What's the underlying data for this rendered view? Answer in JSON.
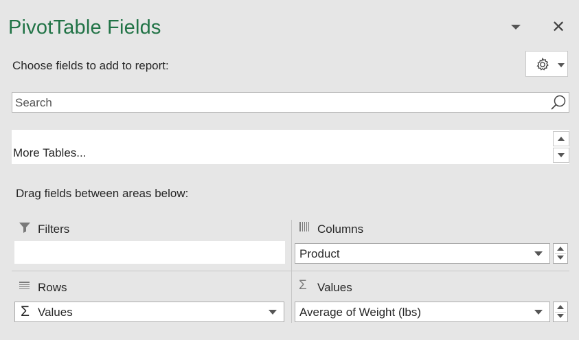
{
  "panel": {
    "title": "PivotTable Fields",
    "choose_label": "Choose fields to add to report:",
    "close_glyph": "✕"
  },
  "search": {
    "placeholder": "Search",
    "value": ""
  },
  "field_list": {
    "more_tables_label": "More Tables..."
  },
  "areas": {
    "drag_label": "Drag fields between areas below:",
    "filters": {
      "title": "Filters",
      "icon": "filter-icon",
      "fields": []
    },
    "columns": {
      "title": "Columns",
      "icon": "columns-icon",
      "fields": [
        "Product"
      ]
    },
    "rows": {
      "title": "Rows",
      "icon": "rows-icon",
      "fields": [
        "Values"
      ],
      "field_icon": "sigma-icon",
      "sigma": "Σ"
    },
    "values": {
      "title": "Values",
      "icon": "sigma-icon",
      "sigma": "Σ",
      "fields": [
        "Average of Weight (lbs)"
      ]
    }
  },
  "colors": {
    "title": "#217346",
    "panel_bg": "#e6e6e6",
    "text": "#262626"
  }
}
